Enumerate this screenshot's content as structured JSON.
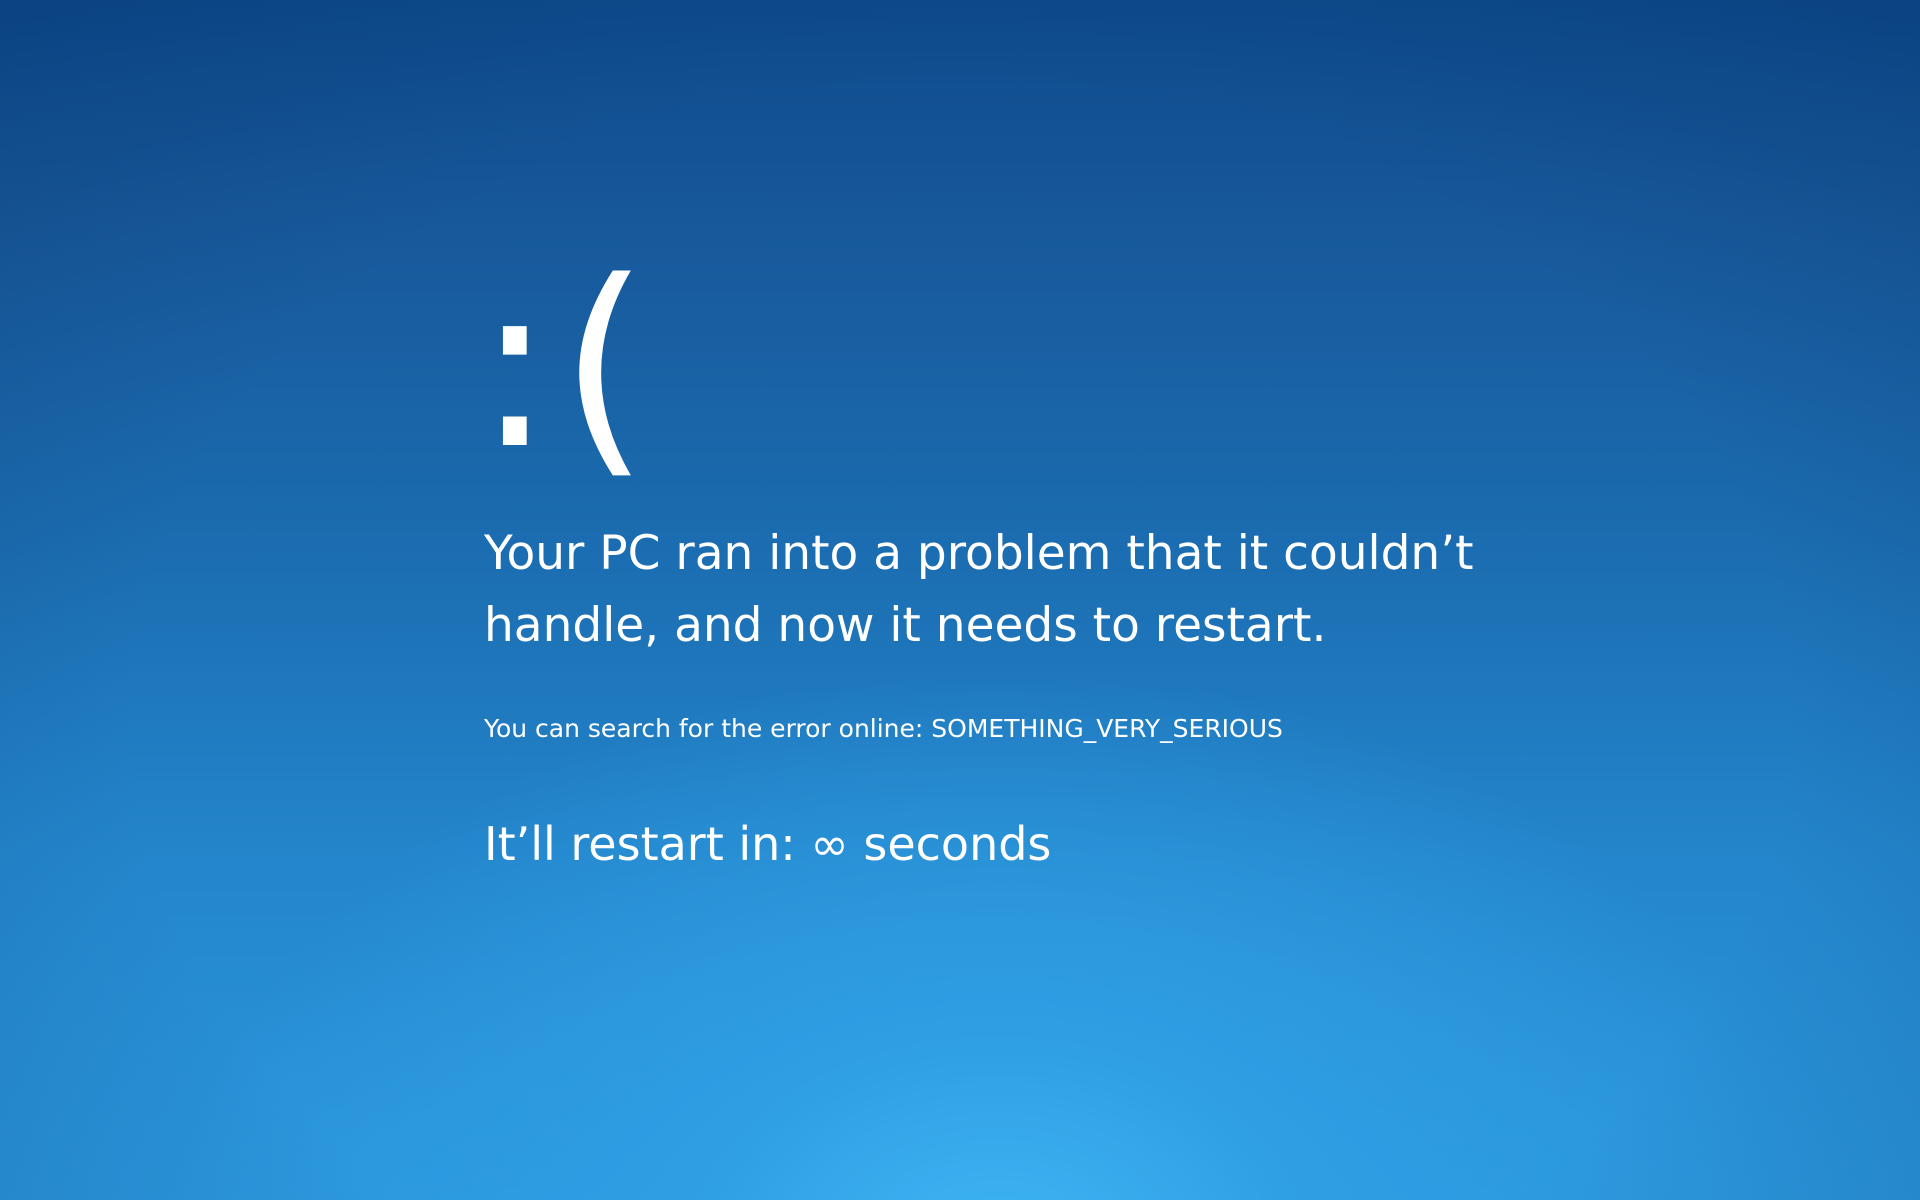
{
  "screen": {
    "face": ":(",
    "headline": "Your PC ran into a problem that it couldn’t handle, and now it needs to restart.",
    "search_text": "You can search for the error online: SOMETHING_VERY_SERIOUS",
    "restart_text": "It’ll restart in: ∞ seconds"
  },
  "colors": {
    "background_top": "#0d4a8c",
    "background_bottom": "#3fb6f5",
    "text": "#ffffff"
  }
}
